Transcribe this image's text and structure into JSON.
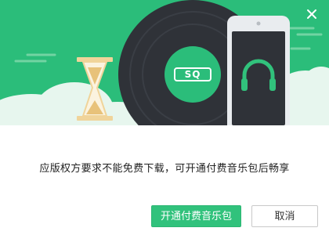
{
  "dialog": {
    "badge_text": "SQ",
    "message": "应版权方要求不能免费下载，可开通付费音乐包后畅享",
    "primary_button_label": "开通付费音乐包",
    "cancel_button_label": "取消"
  },
  "colors": {
    "banner_green": "#2bbd7a",
    "accent_green": "#31c27c",
    "vinyl_dark": "#2f3238",
    "cloud": "#e7f6ee"
  },
  "icons": [
    "close-icon",
    "vinyl-record-icon",
    "headphones-icon",
    "hourglass-icon",
    "phone-icon"
  ]
}
